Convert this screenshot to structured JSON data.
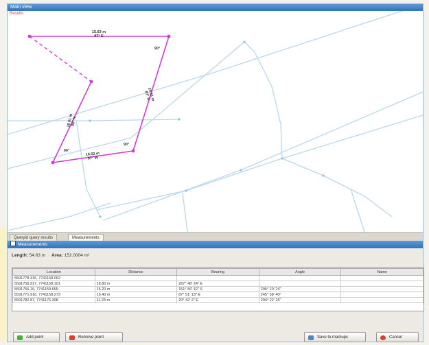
{
  "window": {
    "title": "Main view"
  },
  "map": {
    "results_label": "Results",
    "labels": [
      {
        "lines": [
          "15.63 m",
          "97° E"
        ],
        "rotate": 0
      },
      {
        "lines": [
          "90°"
        ],
        "rotate": 0
      },
      {
        "lines": [
          "19.91 m",
          "87° S"
        ],
        "rotate": 73
      },
      {
        "lines": [
          "90°"
        ],
        "rotate": 0
      },
      {
        "lines": [
          "16.62 m",
          "97° W"
        ],
        "rotate": -5
      },
      {
        "lines": [
          "90°"
        ],
        "rotate": 0
      },
      {
        "lines": [
          "15.01 m",
          "90° N"
        ],
        "rotate": -78
      }
    ],
    "colors": {
      "polygon": "#d63ad6",
      "road": "#b9d7ec"
    }
  },
  "tabs": [
    "Queryid query results",
    "Measurements"
  ],
  "panel": {
    "title": "Measurements"
  },
  "stats": {
    "length_label": "Length:",
    "length_value": "54.63 m",
    "area_label": "Area:",
    "area_value": "152.0004 m²"
  },
  "table": {
    "headers": [
      "Location",
      "Distance",
      "Bearing",
      "Angle",
      "Name"
    ],
    "rows": [
      [
        "5591778.316, 7741158.062",
        "",
        "",
        "",
        ""
      ],
      [
        "5591756.917, 7741158.101",
        "18.80 m",
        "267° 48' 24\" E",
        "",
        ""
      ],
      [
        "5591756.16, 7741159.665",
        "15.20 m",
        "151° 56' 42\" S",
        "206° 20' 24\"",
        ""
      ],
      [
        "5591771.916, 7741158.273",
        "16.40 m",
        "87° 51' 13\" E",
        "245° 58' 40\"",
        ""
      ],
      [
        "5591782.87, 7741176.308",
        "11.23 m",
        "20° 42' 2\" E",
        "204° 22' 15\"",
        ""
      ]
    ]
  },
  "buttons": {
    "add_point": "Add point",
    "remove_point": "Remove point",
    "save": "Save to markups",
    "cancel": "Cancel"
  }
}
